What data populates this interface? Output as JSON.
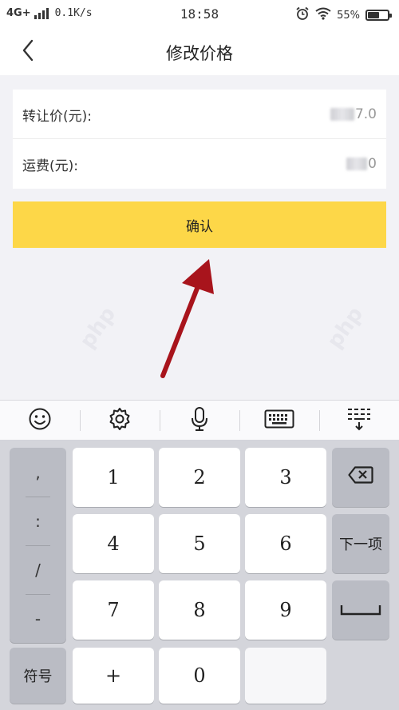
{
  "status_bar": {
    "network": "4G+",
    "speed": "0.1K/s",
    "time": "18:58",
    "battery_percent_label": "55%",
    "battery_level": 0.55
  },
  "header": {
    "title": "修改价格"
  },
  "form": {
    "transfer_price_label": "转让价(元):",
    "transfer_price_value_suffix": "7.0",
    "shipping_label": "运费(元):",
    "shipping_value_suffix": "0"
  },
  "confirm_button": {
    "label": "确认"
  },
  "keyboard": {
    "symbols": [
      ",",
      ":",
      "/",
      "-"
    ],
    "symbol_key": "符号",
    "digits": [
      "1",
      "2",
      "3",
      "4",
      "5",
      "6",
      "7",
      "8",
      "9",
      "0"
    ],
    "plus": "+",
    "next_label": "下一项"
  },
  "colors": {
    "accent": "#fdd748",
    "annotation_arrow": "#a8141c"
  },
  "icons": [
    "back-icon",
    "alarm-icon",
    "wifi-icon",
    "battery-icon",
    "emoji-icon",
    "gear-icon",
    "microphone-icon",
    "keyboard-icon",
    "keyboard-collapse-icon",
    "backspace-icon",
    "space-icon"
  ]
}
